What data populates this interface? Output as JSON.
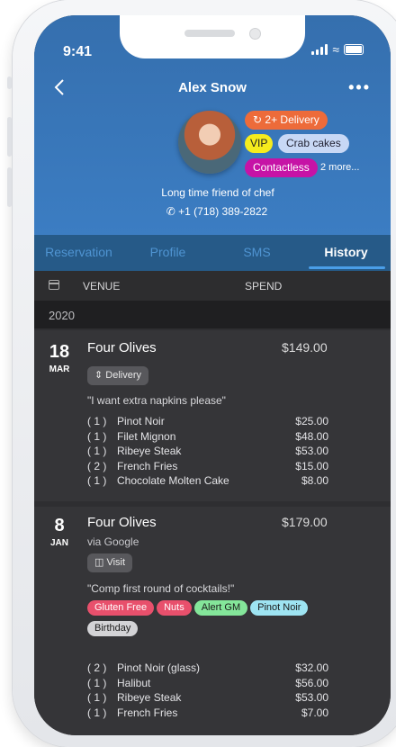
{
  "status": {
    "time": "9:41"
  },
  "header": {
    "back_icon": "chevron-left-icon",
    "title": "Alex Snow",
    "more_icon": "more-dots-icon"
  },
  "guest": {
    "tags": {
      "delivery": "2+ Delivery",
      "vip": "VIP",
      "crab": "Crab cakes",
      "contactless": "Contactless"
    },
    "more_tags": "2 more...",
    "note": "Long time friend of chef",
    "phone": "+1 (718) 389-2822",
    "colors": {
      "delivery": "#ed6b3a",
      "vip": "#f6ec1d",
      "crab": "#c8d8f5",
      "contactless": "#c613a6"
    }
  },
  "tabs": [
    "Reservation",
    "Profile",
    "SMS",
    "History"
  ],
  "active_tab": "History",
  "columns": {
    "venue": "VENUE",
    "spend": "SPEND"
  },
  "year": "2020",
  "visits": [
    {
      "day": "18",
      "month": "MAR",
      "venue": "Four Olives",
      "spend": "$149.00",
      "chip": "Delivery",
      "quote": "\"I want extra napkins please\"",
      "items": [
        {
          "qty": "( 1 )",
          "name": "Pinot Noir",
          "price": "$25.00"
        },
        {
          "qty": "( 1 )",
          "name": "Filet Mignon",
          "price": "$48.00"
        },
        {
          "qty": "( 1 )",
          "name": "Ribeye Steak",
          "price": "$53.00"
        },
        {
          "qty": "( 2 )",
          "name": "French Fries",
          "price": "$15.00"
        },
        {
          "qty": "( 1 )",
          "name": "Chocolate Molten Cake",
          "price": "$8.00"
        }
      ]
    },
    {
      "day": "8",
      "month": "JAN",
      "venue": "Four Olives",
      "spend": "$179.00",
      "source": "via Google",
      "chip": "Visit",
      "quote": "\"Comp first round of cocktails!\"",
      "tags": [
        {
          "label": "Gluten Free",
          "bg": "#e8506c",
          "fg": "#ffffff"
        },
        {
          "label": "Nuts",
          "bg": "#e8506c",
          "fg": "#ffffff"
        },
        {
          "label": "Alert GM",
          "bg": "#84e69a",
          "fg": "#1a1a1a"
        },
        {
          "label": "Pinot Noir",
          "bg": "#9ee4f2",
          "fg": "#1a1a1a"
        },
        {
          "label": "Birthday",
          "bg": "#d3d3d6",
          "fg": "#1a1a1a"
        }
      ],
      "items": [
        {
          "qty": "( 2 )",
          "name": "Pinot Noir (glass)",
          "price": "$32.00"
        },
        {
          "qty": "( 1 )",
          "name": "Halibut",
          "price": "$56.00"
        },
        {
          "qty": "( 1 )",
          "name": "Ribeye Steak",
          "price": "$53.00"
        },
        {
          "qty": "( 1 )",
          "name": "French Fries",
          "price": "$7.00"
        }
      ]
    }
  ]
}
